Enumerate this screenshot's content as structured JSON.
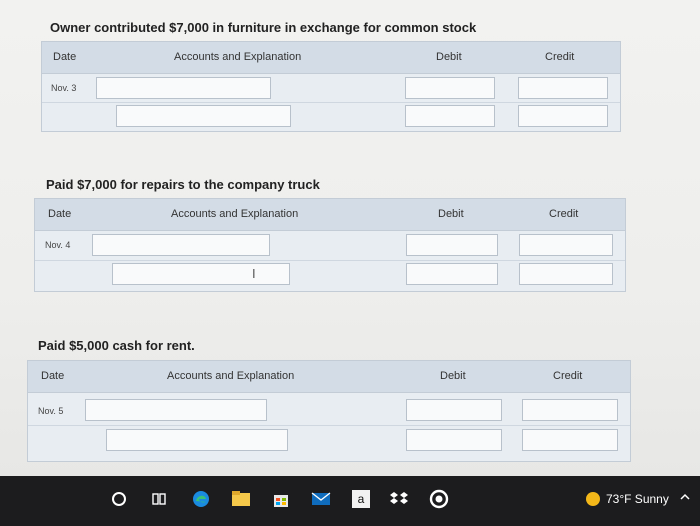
{
  "problems": [
    {
      "prompt": "Owner contributed $7,000 in furniture in exchange for common stock",
      "date": "Nov. 3",
      "headers": {
        "date": "Date",
        "accounts": "Accounts and Explanation",
        "debit": "Debit",
        "credit": "Credit"
      }
    },
    {
      "prompt": "Paid $7,000 for repairs to the company truck",
      "date": "Nov. 4",
      "headers": {
        "date": "Date",
        "accounts": "Accounts and Explanation",
        "debit": "Debit",
        "credit": "Credit"
      }
    },
    {
      "prompt": "Paid $5,000 cash for rent.",
      "date": "Nov. 5",
      "headers": {
        "date": "Date",
        "accounts": "Accounts and Explanation",
        "debit": "Debit",
        "credit": "Credit"
      }
    }
  ],
  "taskbar": {
    "weather": "73°F Sunny",
    "amazon_label": "a",
    "colors": {
      "background": "#1c1c1e",
      "sun": "#f3b719"
    }
  }
}
